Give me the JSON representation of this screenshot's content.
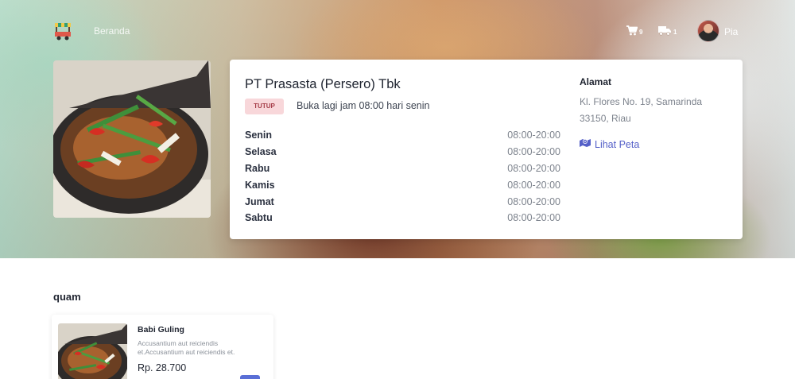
{
  "navbar": {
    "brand": "Beranda",
    "cart_count": "9",
    "delivery_count": "1",
    "user_name": "Pia"
  },
  "store": {
    "name": "PT Prasasta (Persero) Tbk",
    "status_badge": "TUTUP",
    "open_note": "Buka lagi jam 08:00 hari senin",
    "hours": [
      {
        "day": "Senin",
        "time": "08:00-20:00"
      },
      {
        "day": "Selasa",
        "time": "08:00-20:00"
      },
      {
        "day": "Rabu",
        "time": "08:00-20:00"
      },
      {
        "day": "Kamis",
        "time": "08:00-20:00"
      },
      {
        "day": "Jumat",
        "time": "08:00-20:00"
      },
      {
        "day": "Sabtu",
        "time": "08:00-20:00"
      }
    ],
    "address_title": "Alamat",
    "address": "Kl. Flores No. 19, Samarinda 33150, Riau",
    "map_link": "Lihat Peta"
  },
  "section": {
    "title": "quam",
    "products": [
      {
        "name": "Babi Guling",
        "description": "Accusantium aut reiciendis et.Accusantium aut reiciendis et.",
        "price": "Rp. 28.700"
      }
    ]
  },
  "colors": {
    "accent": "#5560c8",
    "badge_bg": "#f8d7da",
    "badge_text": "#a43b46",
    "button": "#5a6fd6"
  }
}
